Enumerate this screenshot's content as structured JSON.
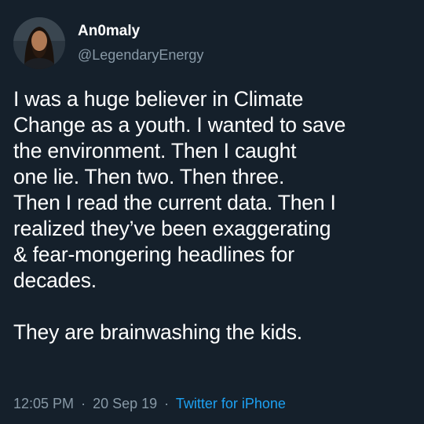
{
  "user": {
    "display_name": "An0maly",
    "handle": "@LegendaryEnergy"
  },
  "tweet": {
    "lines": [
      "I was a huge believer in Climate",
      "Change as a youth. I wanted to save",
      "the environment. Then I caught",
      "one lie. Then two. Then three.",
      "Then I read the current data. Then I",
      "realized they’ve been exaggerating",
      "& fear-mongering headlines for",
      "decades."
    ],
    "closing_line": "They are brainwashing the kids."
  },
  "meta": {
    "time": "12:05 PM",
    "date": "20 Sep 19",
    "separator": "·",
    "source": "Twitter for iPhone"
  },
  "colors": {
    "background": "#15202b",
    "text": "#ffffff",
    "muted": "#8899a6",
    "link": "#1da1f2"
  }
}
